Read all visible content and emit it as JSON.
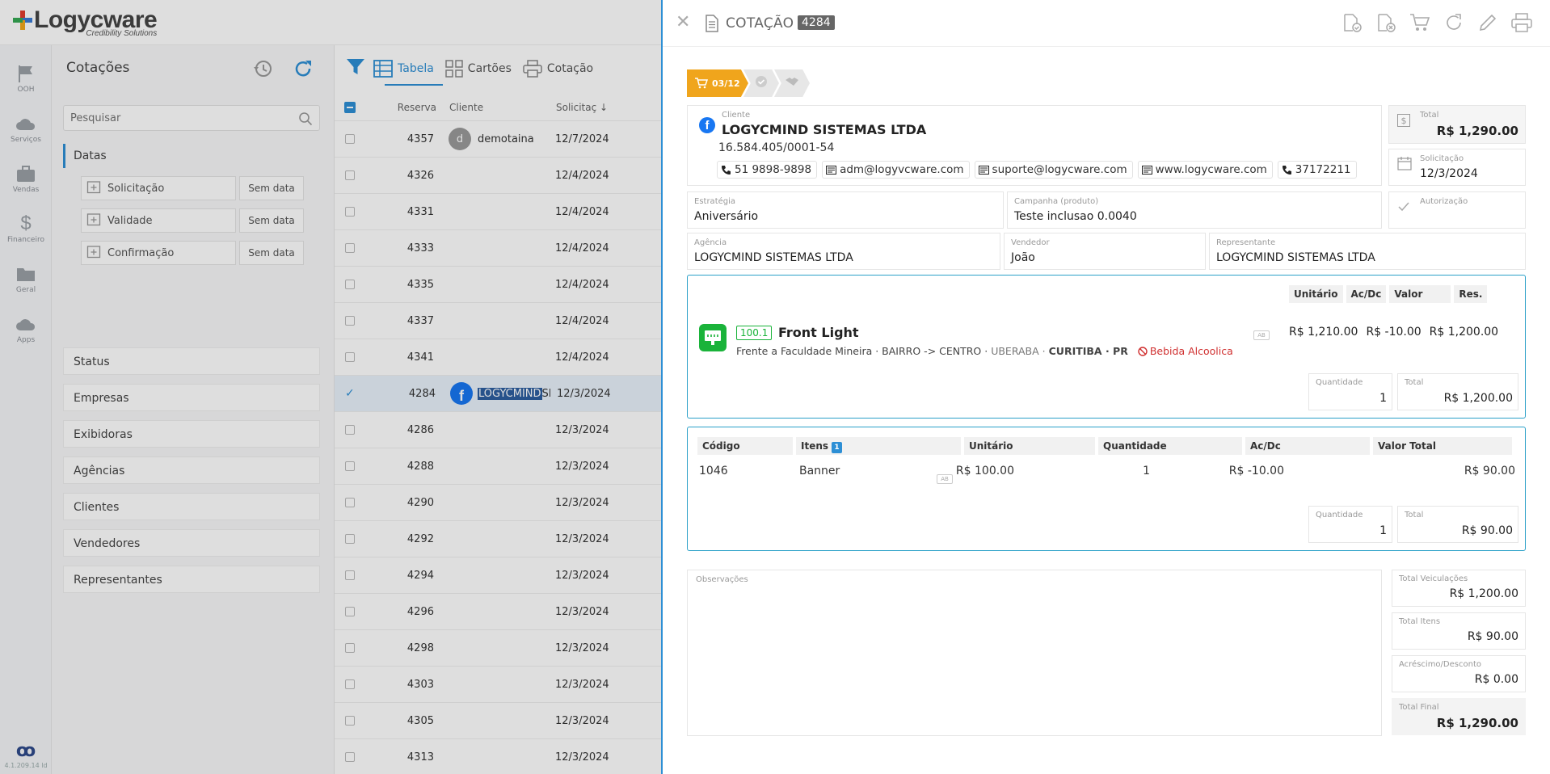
{
  "brand": {
    "name": "Logycware",
    "tagline": "Credibility Solutions",
    "version": "4.1.209.14 ld",
    "bottom_logo": "ꝏ"
  },
  "leftnav": {
    "items": [
      {
        "label": "OOH",
        "icon": "flag-icon"
      },
      {
        "label": "Serviços",
        "icon": "cloud-gear-icon"
      },
      {
        "label": "Vendas",
        "icon": "briefcase-icon"
      },
      {
        "label": "Financeiro",
        "icon": "dollar-icon"
      },
      {
        "label": "Geral",
        "icon": "folder-icon"
      },
      {
        "label": "Apps",
        "icon": "cloud-apps-icon"
      }
    ]
  },
  "filters": {
    "title": "Cotações",
    "search_placeholder": "Pesquisar",
    "datas_label": "Datas",
    "date_rows": [
      {
        "label": "Solicitação",
        "value": "Sem data"
      },
      {
        "label": "Validade",
        "value": "Sem data"
      },
      {
        "label": "Confirmação",
        "value": "Sem data"
      }
    ],
    "sections": [
      "Status",
      "Empresas",
      "Exibidoras",
      "Agências",
      "Clientes",
      "Vendedores",
      "Representantes"
    ]
  },
  "table": {
    "views": [
      "Tabela",
      "Cartões",
      "Cotação"
    ],
    "columns": {
      "reserva": "Reserva",
      "cliente": "Cliente",
      "solicitacao": "Solicitaç ↓"
    },
    "rows": [
      {
        "reserva": "4357",
        "cliente": "demotaina",
        "data": "12/7/2024",
        "avatar": "d",
        "selected": false
      },
      {
        "reserva": "4326",
        "cliente": "",
        "data": "12/4/2024",
        "selected": false
      },
      {
        "reserva": "4331",
        "cliente": "",
        "data": "12/4/2024",
        "selected": false
      },
      {
        "reserva": "4333",
        "cliente": "",
        "data": "12/4/2024",
        "selected": false
      },
      {
        "reserva": "4335",
        "cliente": "",
        "data": "12/4/2024",
        "selected": false
      },
      {
        "reserva": "4337",
        "cliente": "",
        "data": "12/4/2024",
        "selected": false
      },
      {
        "reserva": "4341",
        "cliente": "",
        "data": "12/4/2024",
        "selected": false
      },
      {
        "reserva": "4284",
        "cliente_hl": "LOGYCMIND",
        "cliente_rest": " SI...",
        "data": "12/3/2024",
        "selected": true
      },
      {
        "reserva": "4286",
        "cliente": "",
        "data": "12/3/2024",
        "selected": false
      },
      {
        "reserva": "4288",
        "cliente": "",
        "data": "12/3/2024",
        "selected": false
      },
      {
        "reserva": "4290",
        "cliente": "",
        "data": "12/3/2024",
        "selected": false
      },
      {
        "reserva": "4292",
        "cliente": "",
        "data": "12/3/2024",
        "selected": false
      },
      {
        "reserva": "4294",
        "cliente": "",
        "data": "12/3/2024",
        "selected": false
      },
      {
        "reserva": "4296",
        "cliente": "",
        "data": "12/3/2024",
        "selected": false
      },
      {
        "reserva": "4298",
        "cliente": "",
        "data": "12/3/2024",
        "selected": false
      },
      {
        "reserva": "4303",
        "cliente": "",
        "data": "12/3/2024",
        "selected": false
      },
      {
        "reserva": "4305",
        "cliente": "",
        "data": "12/3/2024",
        "selected": false
      },
      {
        "reserva": "4313",
        "cliente": "",
        "data": "12/3/2024",
        "selected": false
      }
    ]
  },
  "panel": {
    "title": "COTAÇÃO",
    "number": "4284",
    "step1_label": "03/12",
    "client": {
      "label": "Cliente",
      "name": "LOGYCMIND SISTEMAS LTDA",
      "cnpj": "16.584.405/0001-54",
      "chips": [
        {
          "icon": "phone-icon",
          "text": "51 9898-9898"
        },
        {
          "icon": "card-icon",
          "text": "adm@logyvcware.com"
        },
        {
          "icon": "card-icon",
          "text": "suporte@logycware.com"
        },
        {
          "icon": "card-icon",
          "text": "www.logycware.com"
        },
        {
          "icon": "phone-icon",
          "text": "37172211"
        }
      ]
    },
    "total": {
      "label": "Total",
      "value": "R$ 1,290.00"
    },
    "solicitacao": {
      "label": "Solicitação",
      "value": "12/3/2024"
    },
    "estrategia": {
      "label": "Estratégia",
      "value": "Aniversário"
    },
    "campanha": {
      "label": "Campanha (produto)",
      "value": "Teste inclusao 0.0040"
    },
    "autorizacao": {
      "label": "Autorização"
    },
    "agencia": {
      "label": "Agência",
      "value": "LOGYCMIND SISTEMAS LTDA"
    },
    "vendedor": {
      "label": "Vendedor",
      "value": "João"
    },
    "representante": {
      "label": "Representante",
      "value": "LOGYCMIND SISTEMAS LTDA"
    },
    "product": {
      "cols": [
        "Unitário",
        "Ac/Dc",
        "Valor",
        "Res."
      ],
      "badge": "100.1",
      "name": "Front Light",
      "addr_main": "Frente a Faculdade Mineira · BAIRRO -> CENTRO ·",
      "addr_city": "UBERABA ·",
      "addr_state": "CURITIBA · PR",
      "warning": "Bebida Alcoolica",
      "unitario": "R$ 1,210.00",
      "acdc": "R$ -10.00",
      "valor": "R$ 1,200.00",
      "qty_label": "Quantidade",
      "qty": "1",
      "total_label": "Total",
      "total": "R$ 1,200.00",
      "ab": "AB"
    },
    "items": {
      "cols": [
        "Código",
        "Itens",
        "Unitário",
        "Quantidade",
        "Ac/Dc",
        "Valor Total"
      ],
      "count": "1",
      "row": {
        "codigo": "1046",
        "item": "Banner",
        "unitario": "R$ 100.00",
        "quantidade": "1",
        "acdc": "R$ -10.00",
        "valor": "R$ 90.00"
      },
      "qty_label": "Quantidade",
      "qty": "1",
      "total_label": "Total",
      "total": "R$ 90.00",
      "ab": "AB"
    },
    "observacoes_label": "Observações",
    "summary": [
      {
        "label": "Total Veiculações",
        "value": "R$ 1,200.00"
      },
      {
        "label": "Total Itens",
        "value": "R$ 90.00"
      },
      {
        "label": "Acréscimo/Desconto",
        "value": "R$ 0.00"
      },
      {
        "label": "Total Final",
        "value": "R$ 1,290.00"
      }
    ]
  },
  "colors": {
    "accent": "#2d8fd5",
    "step_active": "#f0a51c",
    "product_green": "#1ab33a",
    "warning": "#d03030",
    "facebook": "#1877f2"
  }
}
